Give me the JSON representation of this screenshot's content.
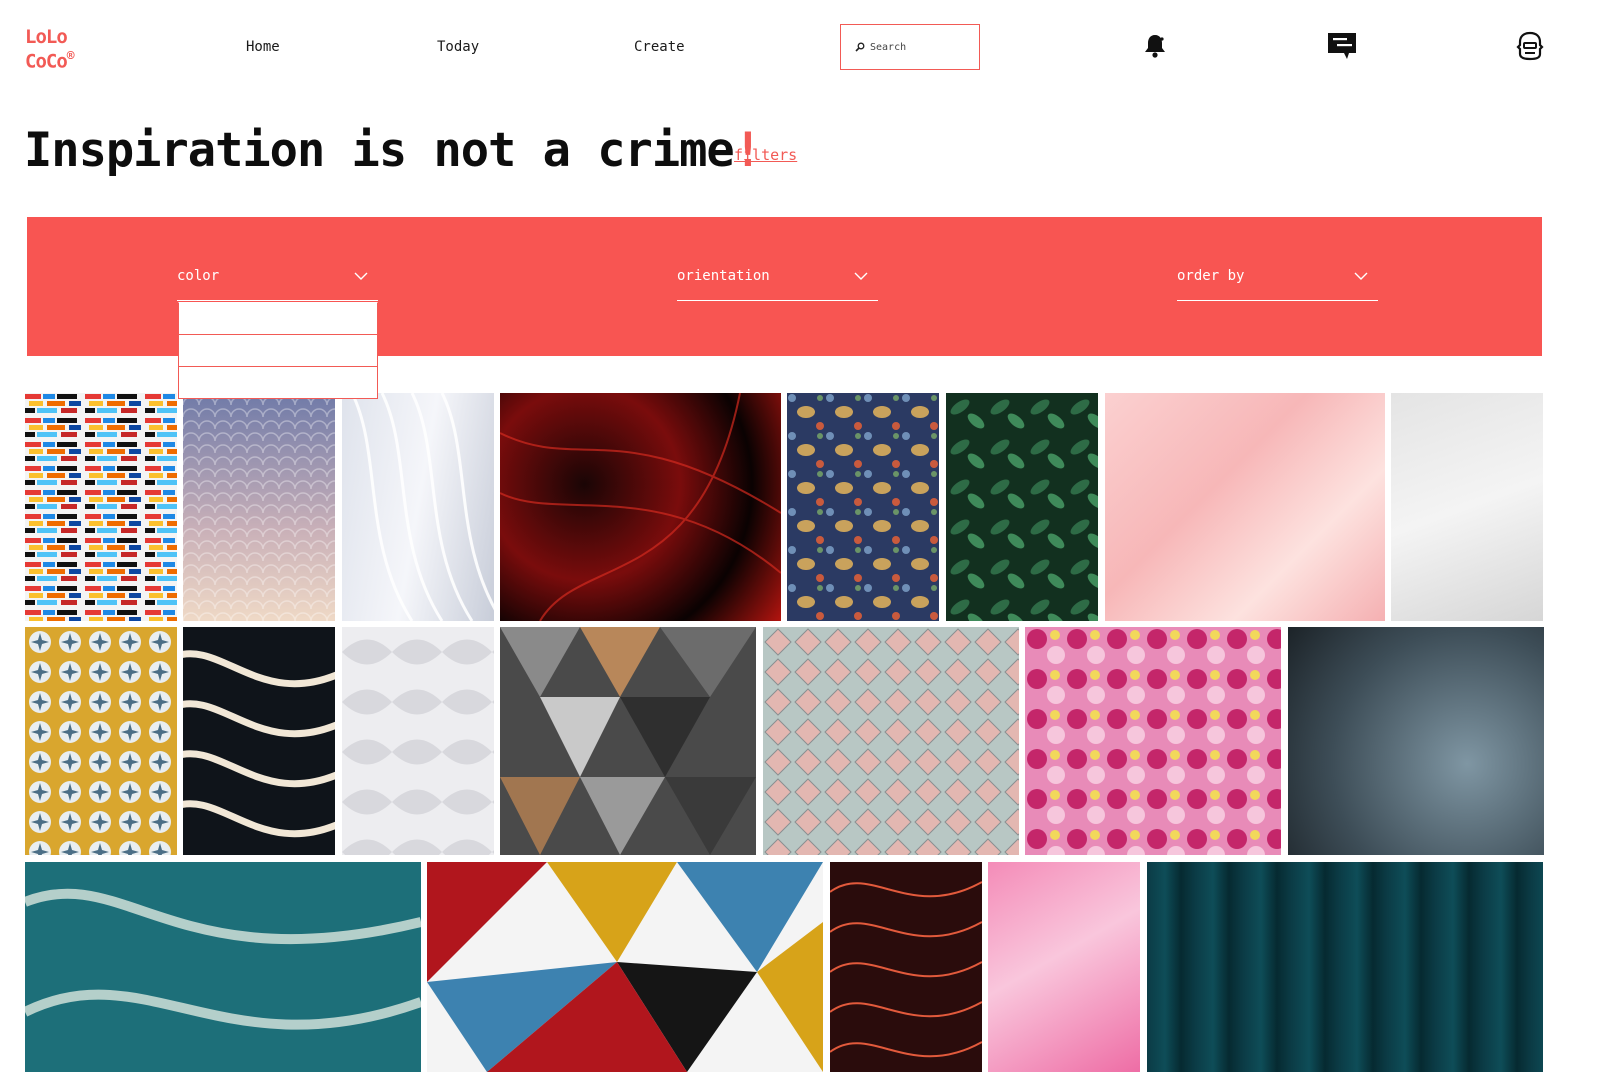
{
  "brand": {
    "line1": "LoLo",
    "line2": "CoCo",
    "mark": "®"
  },
  "nav": {
    "home": "Home",
    "today": "Today",
    "create": "Create"
  },
  "search": {
    "placeholder": "Search",
    "value": ""
  },
  "icons": {
    "search": "search-icon",
    "notifications": "bell-icon",
    "messages": "chat-icon",
    "profile": "avatar-icon"
  },
  "headline": {
    "text": "Inspiration is not a crime",
    "accent": "!"
  },
  "filters_link": "filters",
  "filter_bar": {
    "color_label": "color",
    "orientation_label": "orientation",
    "order_label": "order by",
    "color_options": [
      "",
      "",
      ""
    ]
  },
  "colors": {
    "accent": "#f25a55",
    "filter_bar": "#f85552",
    "text": "#0d0d0d"
  },
  "gallery": {
    "images": [
      "colorful brick stripes",
      "lilac scallop gradient",
      "white wavy lines",
      "red black fractal swirl",
      "floral bird tapestry",
      "green leaves",
      "pink marble",
      "white textured plaster",
      "yellow azulejo tiles",
      "black white wavy stripes",
      "white 3D pattern",
      "metallic geometric triangles",
      "pastel scale tiles",
      "pink roses wall",
      "gray blue stone texture",
      "teal marbled swirl",
      "colorful triangle mosaic",
      "red wavy lines abstract",
      "pink agate",
      "dark teal curtain"
    ]
  }
}
